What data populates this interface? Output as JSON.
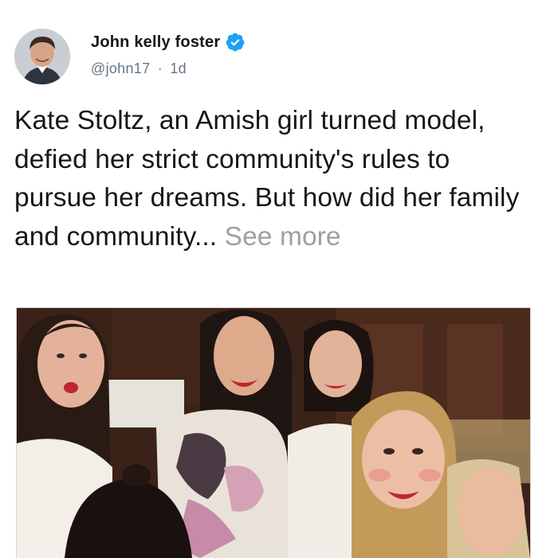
{
  "tweet": {
    "author_name": "John kelly foster",
    "author_handle": "@john17",
    "separator": "·",
    "timestamp": "1d",
    "text": "Kate Stoltz, an Amish girl turned model, defied her strict community's rules to pursue her dreams. But how did her family and community...",
    "see_more_label": "See more"
  },
  "icons": {
    "verified": "verified-badge-icon",
    "avatar": "avatar"
  },
  "colors": {
    "verified_blue": "#1da1f2",
    "text_primary": "#14171a",
    "text_secondary": "#657786",
    "see_more": "#9aa0a6"
  }
}
